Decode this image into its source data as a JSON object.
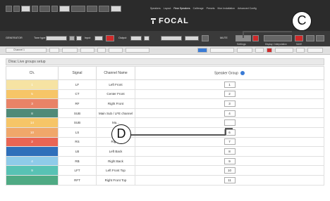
{
  "header": {
    "brand": "FOCAL",
    "top_menu": [
      "Speakers",
      "Layout",
      "Rear Speakers",
      "Calibrage",
      "Presets",
      "Mon Installation",
      "Advanced Config"
    ],
    "generator_label": "GENERATOR",
    "tone_label": "Tone type",
    "source_label": "Input",
    "output_label": "Output",
    "mute_label": "MUTE",
    "save_label": "SAVE",
    "settings_label": "Settings",
    "display_label": "Display / Interpolation",
    "channel_select": "Channel 1"
  },
  "panel": {
    "title": "Dirac Live groups setup",
    "columns": {
      "ch": "Ch.",
      "signal": "Signal",
      "name": "Channel Name",
      "group": "Speaker Group"
    }
  },
  "colors": {
    "rows": [
      "#f6e3a3",
      "#f6c567",
      "#e98367",
      "#4f8a78",
      "#f6c567",
      "#f0a76a",
      "#e96554",
      "#2f6fba",
      "#8fcbe9",
      "#58c2b4",
      "#4faa84"
    ]
  },
  "rows": [
    {
      "ch": "1",
      "signal": "LF",
      "name": "Left Front",
      "group": "1"
    },
    {
      "ch": "5",
      "signal": "CT",
      "name": "Center Front",
      "group": "2"
    },
    {
      "ch": "3",
      "signal": "RF",
      "name": "Right Front",
      "group": "3"
    },
    {
      "ch": "8",
      "signal": "SUB",
      "name": "Main Sub / LFE channel",
      "group": "4"
    },
    {
      "ch": "14",
      "signal": "SUB",
      "name": "Ma...",
      "group": ""
    },
    {
      "ch": "10",
      "signal": "LS",
      "name": "",
      "group": "6"
    },
    {
      "ch": "2",
      "signal": "RS",
      "name": "Righ...",
      "group": "7"
    },
    {
      "ch": "",
      "signal": "LB",
      "name": "Left Back",
      "group": "8"
    },
    {
      "ch": "4",
      "signal": "RB",
      "name": "Right Back",
      "group": "9"
    },
    {
      "ch": "9",
      "signal": "LFT",
      "name": "Left Front Top",
      "group": "10"
    },
    {
      "ch": "",
      "signal": "RFT",
      "name": "Right Front Top",
      "group": "11"
    }
  ],
  "callouts": {
    "c": "C",
    "d": "D"
  }
}
